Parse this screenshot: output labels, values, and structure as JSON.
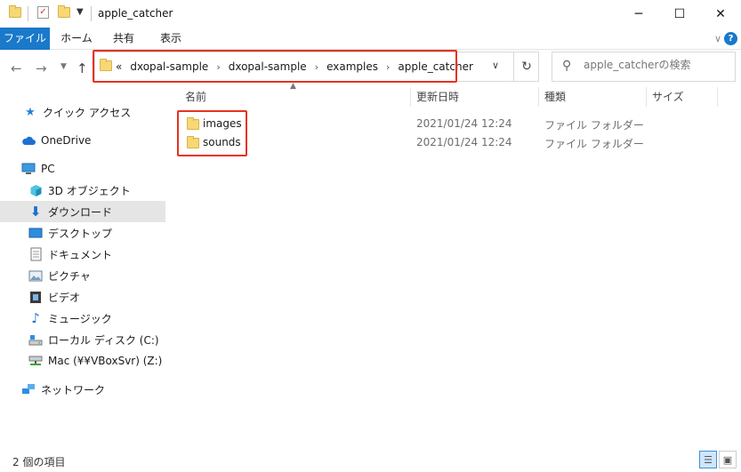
{
  "window": {
    "title": "apple_catcher",
    "minimize": "─",
    "maximize": "☐",
    "close": "✕"
  },
  "ribbon": {
    "tabs": [
      "ファイル",
      "ホーム",
      "共有",
      "表示"
    ]
  },
  "address": {
    "prefix": "«",
    "crumbs": [
      "dxopal-sample",
      "dxopal-sample",
      "examples",
      "apple_catcher"
    ]
  },
  "search": {
    "placeholder": "apple_catcherの検索"
  },
  "nav": {
    "items": [
      {
        "label": "クイック アクセス",
        "icon": "star-icon"
      },
      {
        "label": "OneDrive",
        "icon": "cloud-icon"
      },
      {
        "label": "PC",
        "icon": "computer-icon"
      },
      {
        "label": "3D オブジェクト",
        "icon": "cube-icon"
      },
      {
        "label": "ダウンロード",
        "icon": "download-icon"
      },
      {
        "label": "デスクトップ",
        "icon": "desktop-icon"
      },
      {
        "label": "ドキュメント",
        "icon": "document-icon"
      },
      {
        "label": "ピクチャ",
        "icon": "picture-icon"
      },
      {
        "label": "ビデオ",
        "icon": "video-icon"
      },
      {
        "label": "ミュージック",
        "icon": "music-icon"
      },
      {
        "label": "ローカル ディスク (C:)",
        "icon": "disk-icon"
      },
      {
        "label": "Mac (¥¥VBoxSvr) (Z:)",
        "icon": "network-drive-icon"
      },
      {
        "label": "ネットワーク",
        "icon": "network-icon"
      }
    ]
  },
  "columns": {
    "name": "名前",
    "date": "更新日時",
    "type": "種類",
    "size": "サイズ"
  },
  "files": [
    {
      "name": "images",
      "date": "2021/01/24 12:24",
      "type": "ファイル フォルダー"
    },
    {
      "name": "sounds",
      "date": "2021/01/24 12:24",
      "type": "ファイル フォルダー"
    }
  ],
  "status": {
    "count": "2 個の項目"
  },
  "colors": {
    "accent": "#1979ca",
    "highlight": "#e8321e",
    "selected": "#e5e5e5"
  }
}
